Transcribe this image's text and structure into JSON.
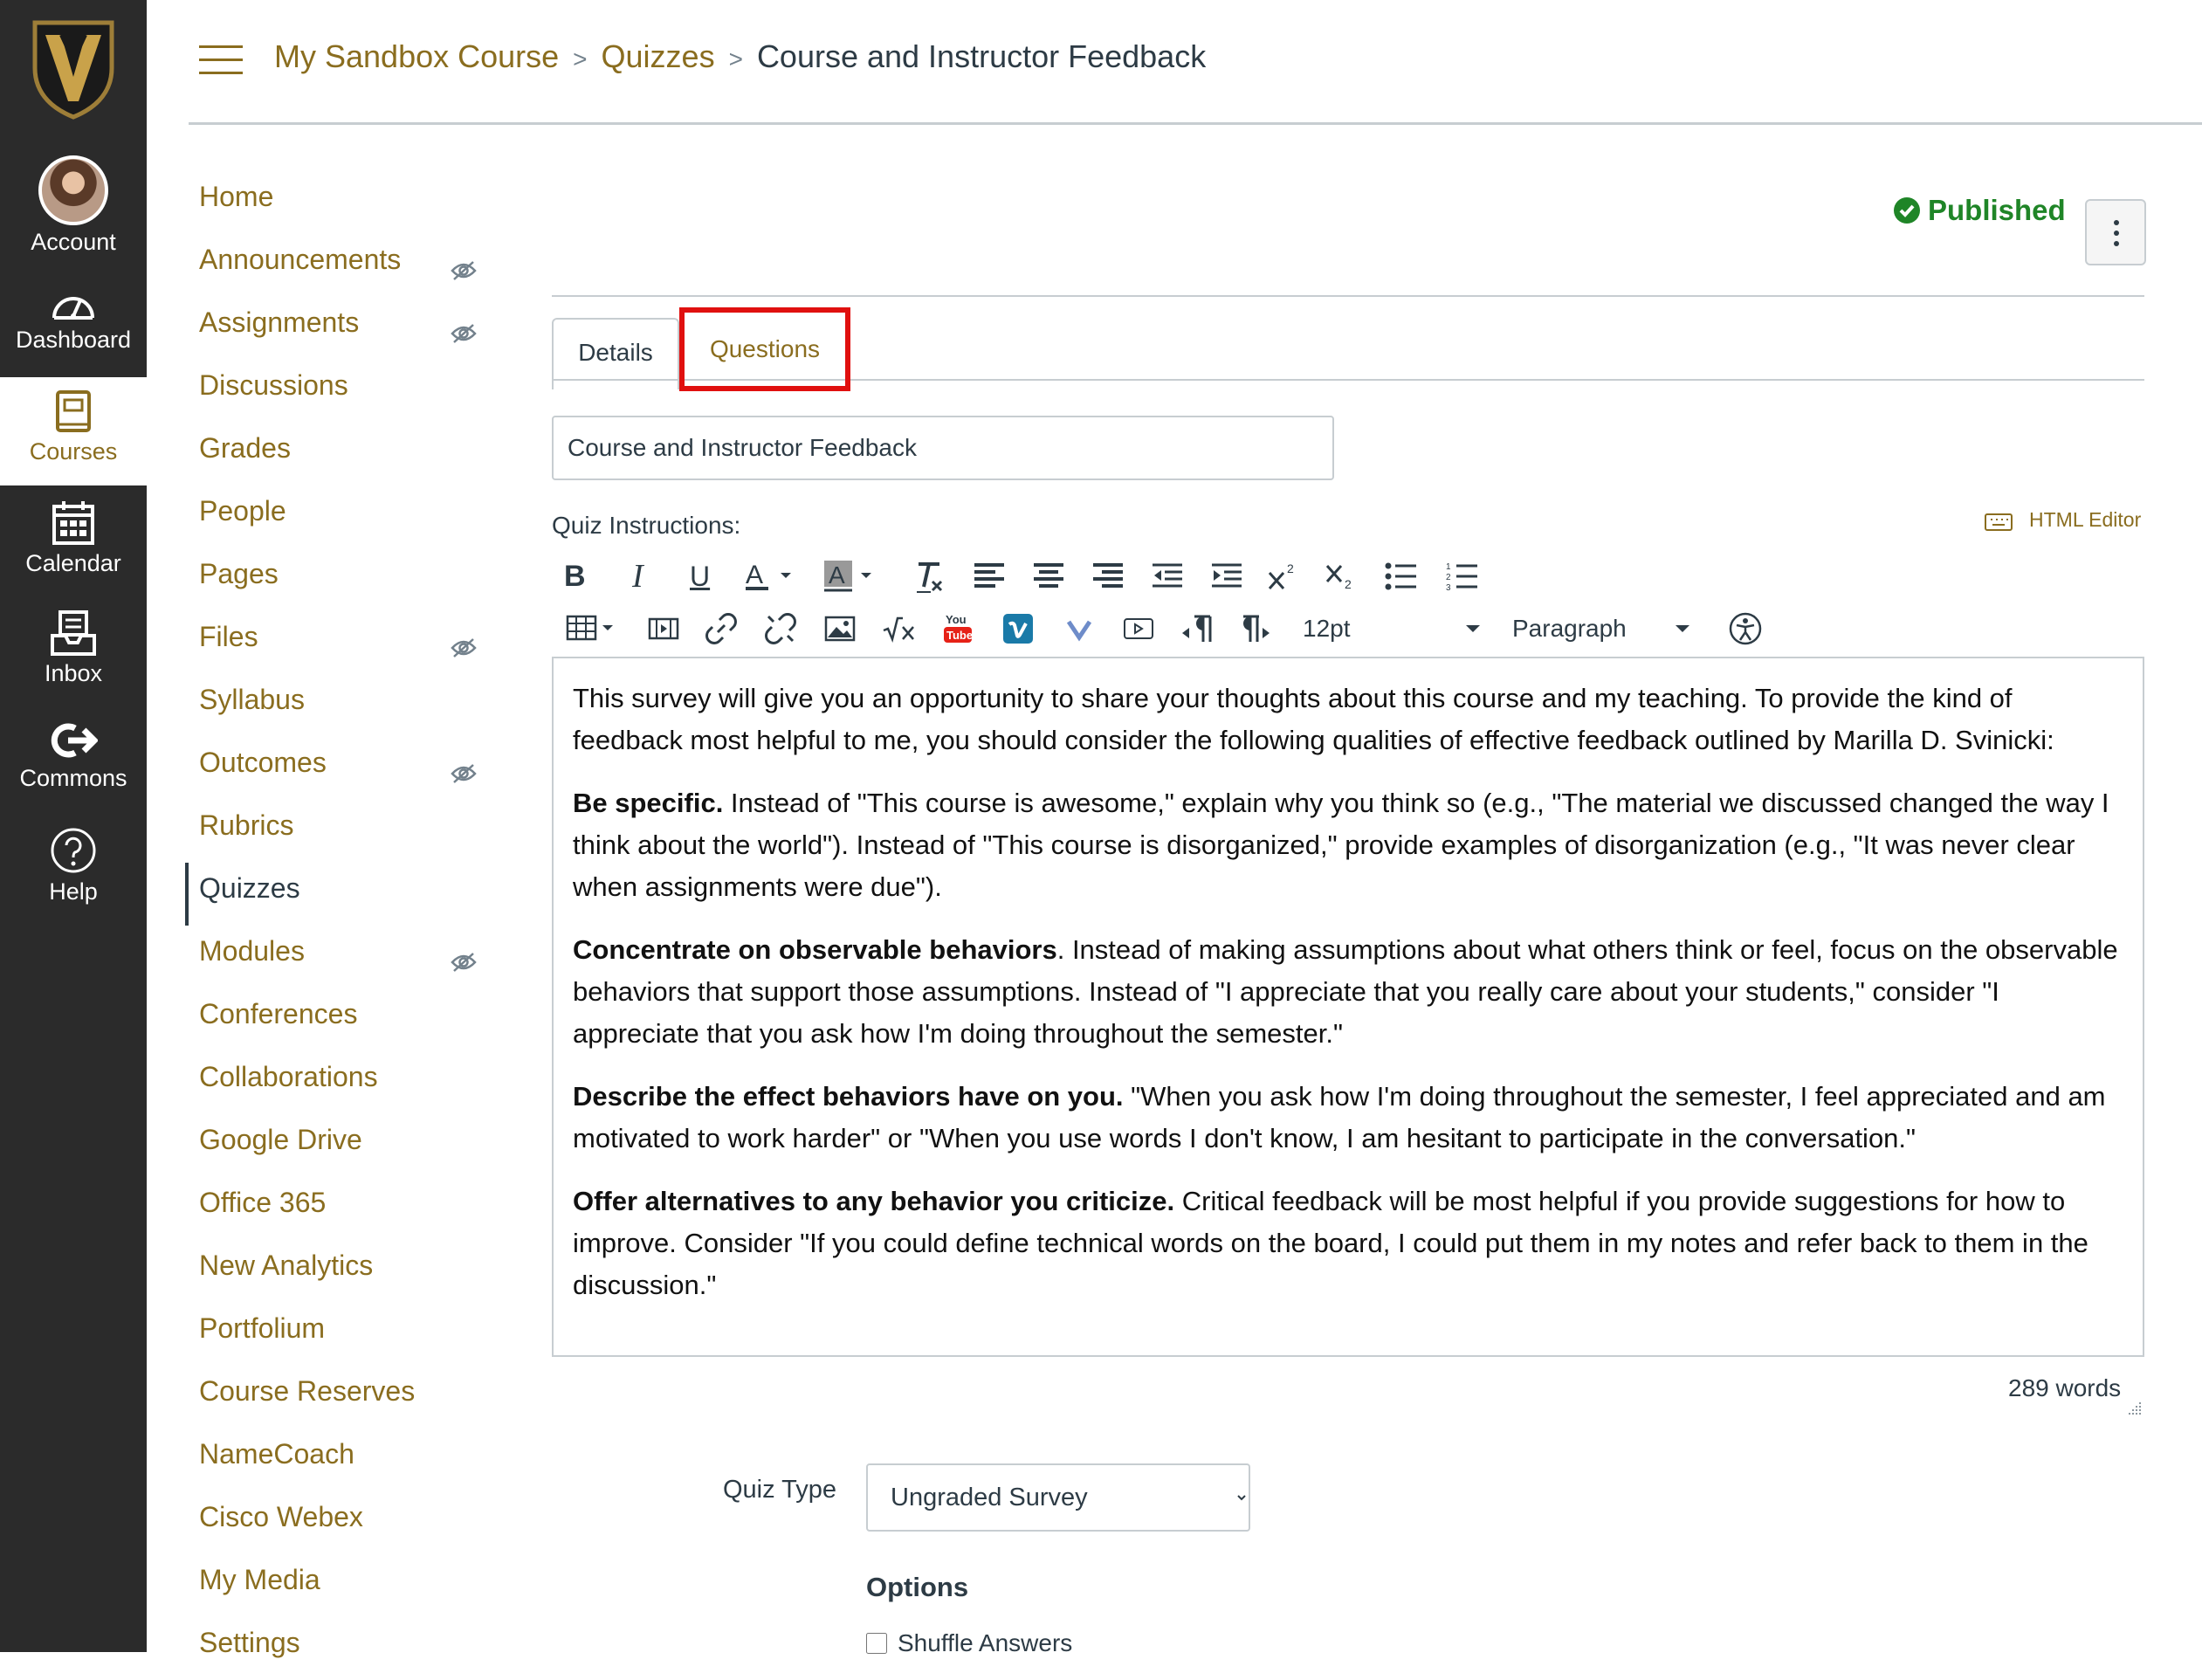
{
  "global_nav": {
    "items": [
      {
        "label": "Account",
        "icon": "avatar"
      },
      {
        "label": "Dashboard",
        "icon": "dashboard-icon"
      },
      {
        "label": "Courses",
        "icon": "courses-icon",
        "active": true
      },
      {
        "label": "Calendar",
        "icon": "calendar-icon"
      },
      {
        "label": "Inbox",
        "icon": "inbox-icon"
      },
      {
        "label": "Commons",
        "icon": "commons-icon"
      },
      {
        "label": "Help",
        "icon": "help-icon"
      }
    ]
  },
  "breadcrumb": {
    "course": "My Sandbox Course",
    "section": "Quizzes",
    "current": "Course and Instructor Feedback",
    "separator": ">"
  },
  "course_nav": {
    "items": [
      {
        "label": "Home",
        "hidden": false
      },
      {
        "label": "Announcements",
        "hidden": true
      },
      {
        "label": "Assignments",
        "hidden": true
      },
      {
        "label": "Discussions",
        "hidden": false
      },
      {
        "label": "Grades",
        "hidden": false
      },
      {
        "label": "People",
        "hidden": false
      },
      {
        "label": "Pages",
        "hidden": false
      },
      {
        "label": "Files",
        "hidden": true
      },
      {
        "label": "Syllabus",
        "hidden": false
      },
      {
        "label": "Outcomes",
        "hidden": true
      },
      {
        "label": "Rubrics",
        "hidden": false
      },
      {
        "label": "Quizzes",
        "hidden": false,
        "active": true
      },
      {
        "label": "Modules",
        "hidden": true
      },
      {
        "label": "Conferences",
        "hidden": false
      },
      {
        "label": "Collaborations",
        "hidden": false
      },
      {
        "label": "Google Drive",
        "hidden": false
      },
      {
        "label": "Office 365",
        "hidden": false
      },
      {
        "label": "New Analytics",
        "hidden": false
      },
      {
        "label": "Portfolium",
        "hidden": false
      },
      {
        "label": "Course Reserves",
        "hidden": false
      },
      {
        "label": "NameCoach",
        "hidden": false
      },
      {
        "label": "Cisco Webex",
        "hidden": false
      },
      {
        "label": "My Media",
        "hidden": false
      },
      {
        "label": "Settings",
        "hidden": false
      }
    ]
  },
  "status": {
    "published_label": "Published"
  },
  "tabs": {
    "details": "Details",
    "questions": "Questions"
  },
  "quiz": {
    "title_value": "Course and Instructor Feedback",
    "instructions_label": "Quiz Instructions:",
    "html_editor_label": "HTML Editor",
    "font_size": "12pt",
    "block_format": "Paragraph",
    "body": [
      {
        "bold": "",
        "text": "This survey will give you an opportunity to share your thoughts about this course and my teaching. To provide the kind of feedback most helpful to me, you should consider the following qualities of effective feedback outlined by Marilla D. Svinicki:"
      },
      {
        "bold": "Be specific.",
        "text": " Instead of \"This course is awesome,\" explain why you think so (e.g., \"The material we discussed changed the way I think about the world\"). Instead of \"This course is disorganized,\" provide examples of disorganization (e.g., \"It was never clear when assignments were due\")."
      },
      {
        "bold": "Concentrate on observable behaviors",
        "text": ". Instead of making assumptions about what others think or feel, focus on the observable behaviors that support those assumptions. Instead of \"I appreciate that you really care about your students,\" consider \"I appreciate that you ask how I'm doing throughout the semester.\""
      },
      {
        "bold": "Describe the effect behaviors have on you.",
        "text": " \"When you ask how I'm doing throughout the semester, I feel appreciated and am motivated to work harder\" or \"When you use words I don't know, I am hesitant to participate in the conversation.\""
      },
      {
        "bold": "Offer alternatives to any behavior you criticize.",
        "text": " Critical feedback will be most helpful if you provide suggestions for how to improve. Consider \"If you could define technical words on the board, I could put them in my notes and refer back to them in the discussion.\""
      }
    ],
    "word_count": "289 words",
    "quiz_type_label": "Quiz Type",
    "quiz_type_value": "Ungraded Survey",
    "options_heading": "Options",
    "shuffle_label": "Shuffle Answers"
  },
  "colors": {
    "brand": "#8a6d1f",
    "nav_bg": "#2b2b2b",
    "published": "#1f8527",
    "highlight": "#e0100f"
  }
}
